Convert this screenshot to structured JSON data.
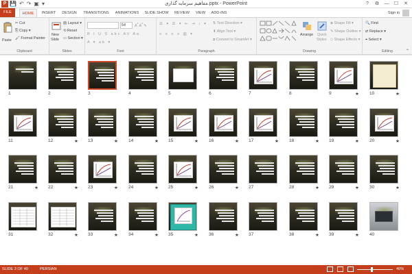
{
  "titlebar": {
    "app_logo": "P",
    "title": "مفاهیم سرمایه گذاری.pptx - PowerPoint",
    "qat": [
      "save-icon",
      "undo-icon",
      "redo-icon",
      "start-slideshow-icon",
      "qat-more-icon"
    ],
    "qat_glyphs": [
      "💾",
      "↶",
      "↷",
      "▣",
      "▾"
    ],
    "window_controls": [
      "?",
      "⧉",
      "—",
      "☐",
      "✕"
    ]
  },
  "tabs": [
    {
      "label": "FILE",
      "kind": "file"
    },
    {
      "label": "HOME",
      "kind": "active"
    },
    {
      "label": "INSERT"
    },
    {
      "label": "DESIGN"
    },
    {
      "label": "TRANSITIONS"
    },
    {
      "label": "ANIMATIONS"
    },
    {
      "label": "SLIDE SHOW"
    },
    {
      "label": "REVIEW"
    },
    {
      "label": "VIEW"
    },
    {
      "label": "ADD-INS"
    }
  ],
  "signin": "Sign in",
  "ribbon": {
    "clipboard": {
      "paste": "Paste",
      "cut": "Cut",
      "copy": "Copy",
      "format_painter": "Format Painter",
      "label": "Clipboard"
    },
    "slides": {
      "new_slide_1": "New",
      "new_slide_2": "Slide",
      "layout": "Layout",
      "reset": "Reset",
      "section": "Section",
      "label": "Slides"
    },
    "font": {
      "size": "54",
      "label": "Font"
    },
    "paragraph": {
      "text_direction": "Text Direction",
      "align_text": "Align Text",
      "convert_smartart": "Convert to SmartArt",
      "label": "Paragraph"
    },
    "drawing": {
      "arrange": "Arrange",
      "quick_styles_1": "Quick",
      "quick_styles_2": "Styles",
      "shape_fill": "Shape Fill",
      "shape_outline": "Shape Outline",
      "shape_effects": "Shape Effects",
      "label": "Drawing"
    },
    "editing": {
      "find": "Find",
      "replace": "Replace",
      "select": "Select",
      "label": "Editing"
    }
  },
  "slides": [
    {
      "n": "1",
      "star": false,
      "variant": "title"
    },
    {
      "n": "2",
      "star": false,
      "variant": "text"
    },
    {
      "n": "3",
      "star": false,
      "variant": "text",
      "selected": true
    },
    {
      "n": "4",
      "star": false,
      "variant": "text"
    },
    {
      "n": "5",
      "star": false,
      "variant": "whitebox"
    },
    {
      "n": "6",
      "star": false,
      "variant": "text"
    },
    {
      "n": "7",
      "star": false,
      "variant": "chart"
    },
    {
      "n": "8",
      "star": false,
      "variant": "text"
    },
    {
      "n": "9",
      "star": true,
      "variant": "chart"
    },
    {
      "n": "10",
      "star": true,
      "variant": "cream"
    },
    {
      "n": "11",
      "star": false,
      "variant": "chart"
    },
    {
      "n": "12",
      "star": true,
      "variant": "text"
    },
    {
      "n": "13",
      "star": true,
      "variant": "text"
    },
    {
      "n": "14",
      "star": true,
      "variant": "text"
    },
    {
      "n": "15",
      "star": true,
      "variant": "chart"
    },
    {
      "n": "16",
      "star": true,
      "variant": "chart"
    },
    {
      "n": "17",
      "star": true,
      "variant": "chart"
    },
    {
      "n": "18",
      "star": true,
      "variant": "text"
    },
    {
      "n": "19",
      "star": true,
      "variant": "text"
    },
    {
      "n": "20",
      "star": true,
      "variant": "chart"
    },
    {
      "n": "21",
      "star": true,
      "variant": "text"
    },
    {
      "n": "22",
      "star": true,
      "variant": "text"
    },
    {
      "n": "23",
      "star": true,
      "variant": "chart"
    },
    {
      "n": "24",
      "star": true,
      "variant": "text"
    },
    {
      "n": "25",
      "star": true,
      "variant": "chart"
    },
    {
      "n": "26",
      "star": true,
      "variant": "text"
    },
    {
      "n": "27",
      "star": false,
      "variant": "text"
    },
    {
      "n": "28",
      "star": true,
      "variant": "text"
    },
    {
      "n": "29",
      "star": true,
      "variant": "text"
    },
    {
      "n": "30",
      "star": true,
      "variant": "text"
    },
    {
      "n": "31",
      "star": false,
      "variant": "table"
    },
    {
      "n": "32",
      "star": true,
      "variant": "table"
    },
    {
      "n": "33",
      "star": true,
      "variant": "text"
    },
    {
      "n": "34",
      "star": true,
      "variant": "text"
    },
    {
      "n": "35",
      "star": true,
      "variant": "teal"
    },
    {
      "n": "36",
      "star": true,
      "variant": "text"
    },
    {
      "n": "37",
      "star": false,
      "variant": "text"
    },
    {
      "n": "38",
      "star": true,
      "variant": "text"
    },
    {
      "n": "39",
      "star": true,
      "variant": "text"
    },
    {
      "n": "40",
      "star": false,
      "variant": "photo"
    }
  ],
  "statusbar": {
    "slide_info": "SLIDE 3 OF 40",
    "language": "PERSIAN",
    "zoom": "40%"
  },
  "colors": {
    "accent": "#c43e1c",
    "selection": "#d24726"
  }
}
